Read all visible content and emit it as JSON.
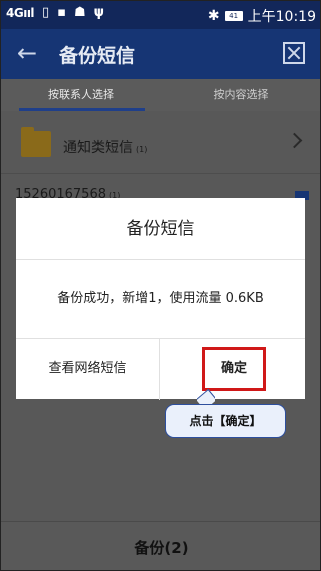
{
  "status_bar": {
    "left_network": "4G",
    "left_signal": "4Gııl",
    "time": "上午10:19",
    "battery": "41"
  },
  "app_bar": {
    "title": "备份短信"
  },
  "tabs": [
    {
      "label": "按联系人选择"
    },
    {
      "label": "按内容选择"
    }
  ],
  "list": {
    "folder_label": "通知类短信",
    "folder_count": "(1)",
    "phone": "15260167568",
    "phone_count": "(1)"
  },
  "bottom": {
    "button_label": "备份(2)"
  },
  "dialog": {
    "title": "备份短信",
    "message": "备份成功，新增1，使用流量 0.6KB",
    "left_button": "查看网络短信",
    "right_button": "确定"
  },
  "annotation": {
    "text": "点击【确定】"
  },
  "colors": {
    "appbar": "#163574",
    "highlight": "#d01818"
  }
}
